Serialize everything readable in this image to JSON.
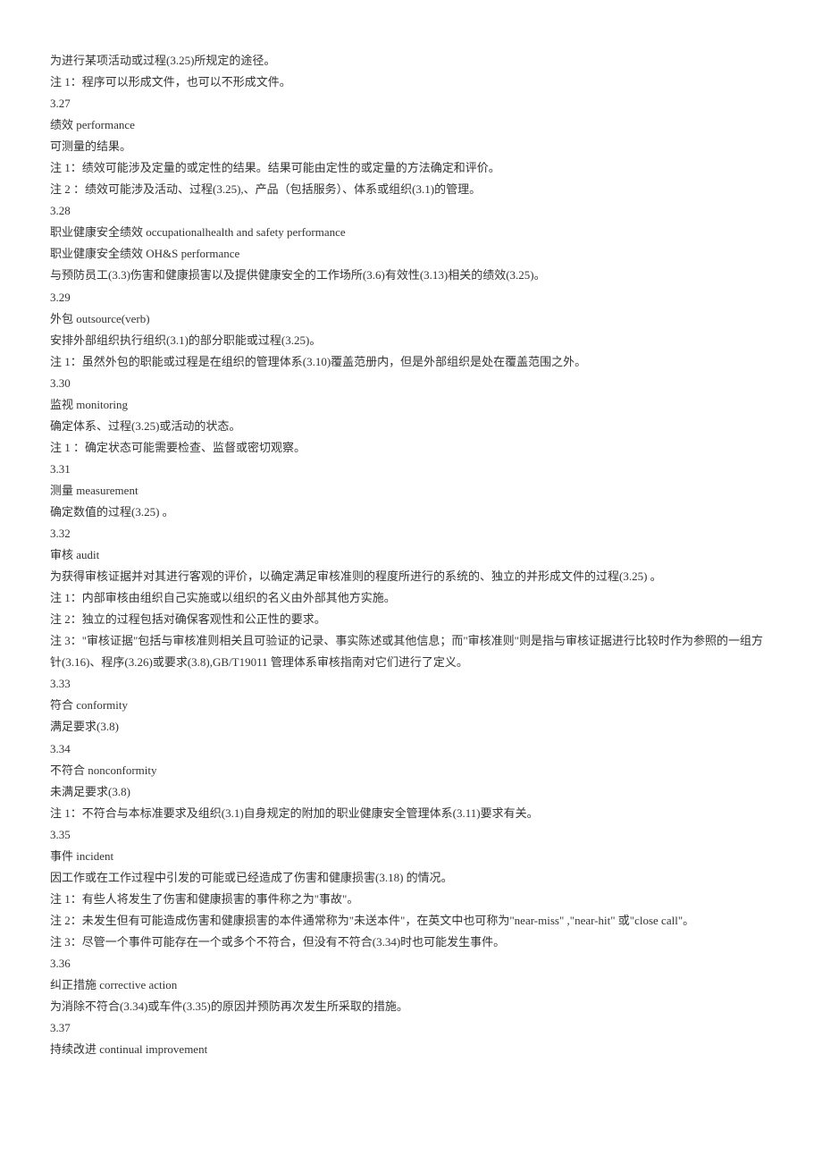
{
  "lines": [
    "为进行某项活动或过程(3.25)所规定的途径。",
    "注 1：程序可以形成文件，也可以不形成文件。",
    "3.27",
    "绩效 performance",
    "可测量的结果。",
    "注 1：绩效可能涉及定量的或定性的结果。结果可能由定性的或定量的方法确定和评价。",
    "注 2 ：绩效可能涉及活动、过程(3.25),、产品（包括服务）、体系或组织(3.1)的管理。",
    "3.28",
    "职业健康安全绩效 occupationalhealth and safety performance",
    "职业健康安全绩效 OH&S performance",
    "与预防员工(3.3)伤害和健康损害以及提供健康安全的工作场所(3.6)有效性(3.13)相关的绩效(3.25)。",
    "3.29",
    "外包 outsource(verb)",
    "安排外部组织执行组织(3.1)的部分职能或过程(3.25)。",
    "注 1：虽然外包的职能或过程是在组织的管理体系(3.10)覆盖范册内，但是外部组织是处在覆盖范围之外。",
    "3.30",
    "监视 monitoring",
    "确定体系、过程(3.25)或活动的状态。",
    "注 1 ：确定状态可能需要检查、监督或密切观察。",
    "3.31",
    "测量 measurement",
    "确定数值的过程(3.25) 。",
    "3.32",
    "审核 audit",
    "为获得审核证据并对其进行客观的评价，以确定满足审核准则的程度所进行的系统的、独立的并形成文件的过程(3.25) 。",
    "注 1：内部审核由组织自己实施或以组织的名义由外部其他方实施。",
    "注 2：独立的过程包括对确保客观性和公正性的要求。",
    "注 3：\"审核证据\"包括与审核准则相关且可验证的记录、事实陈述或其他信息；而\"审核准则\"则是指与审核证据进行比较时作为参照的一组方针(3.16)、程序(3.26)或要求(3.8),GB/T19011 管理体系审核指南对它们进行了定义。",
    "3.33",
    "符合 conformity",
    "满足要求(3.8)",
    "3.34",
    "不符合 nonconformity",
    "未满足要求(3.8)",
    "注 1：不符合与本标准要求及组织(3.1)自身规定的附加的职业健康安全管理体系(3.11)要求有关。",
    "3.35",
    "事件 incident",
    "因工作或在工作过程中引发的可能或已经造成了伤害和健康损害(3.18) 的情况。",
    "注 1：有些人将发生了伤害和健康损害的事件称之为\"事故\"。",
    "注 2：未发生但有可能造成伤害和健康损害的本件通常称为\"未送本件\"，在英文中也可称为\"near-miss\" ,\"near-hit\" 或\"close call\"。",
    "注 3：尽管一个事件可能存在一个或多个不符合，但没有不符合(3.34)时也可能发生事件。",
    "3.36",
    "纠正措施 corrective action",
    "为消除不符合(3.34)或车件(3.35)的原因并预防再次发生所采取的措施。",
    "3.37",
    "持续改进 continual improvement"
  ]
}
